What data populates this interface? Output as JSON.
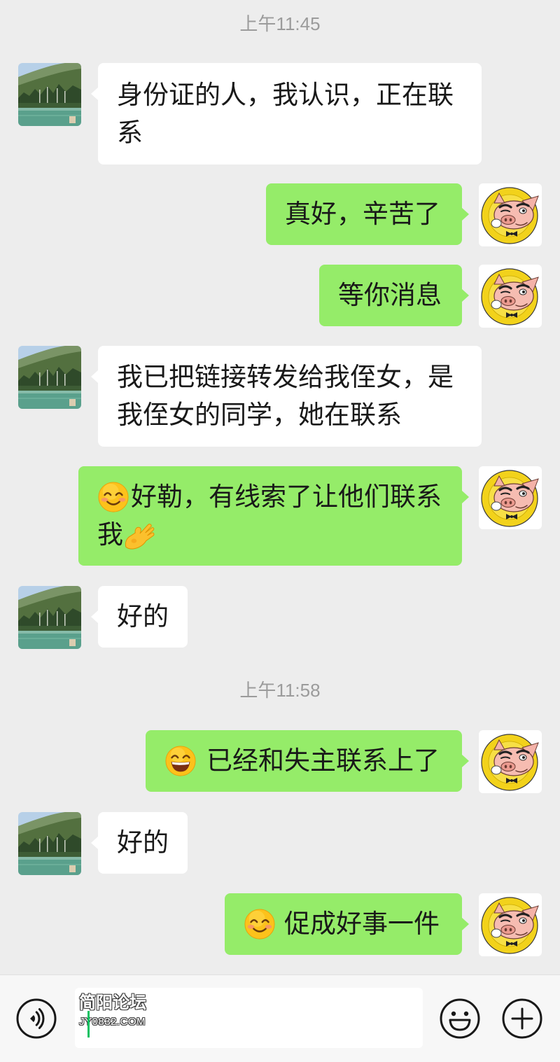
{
  "theme": {
    "chat_background": "#ededed",
    "bubble_me": "#95ec69",
    "bubble_other": "#ffffff",
    "timestamp_color": "#9b9b9b",
    "message_text_color": "#191919",
    "input_bar_background": "#f7f7f7",
    "cursor_color": "#07c160"
  },
  "avatars": {
    "other": "landscape-photo-avatar",
    "me": "pig-cartoon-avatar",
    "me_logo_text": "WWW.JY0832.COM"
  },
  "chat": {
    "timestamps": [
      "上午11:45",
      "上午11:58"
    ],
    "messages": [
      {
        "outgoing": false,
        "lines": [
          "身份证的人，我认识，正在联",
          "系"
        ]
      },
      {
        "outgoing": true,
        "lines": [
          "真好，辛苦了"
        ]
      },
      {
        "outgoing": true,
        "lines": [
          "等你消息"
        ]
      },
      {
        "outgoing": false,
        "lines": [
          "我已把链接转发给我侄女，是",
          "我侄女的同学，她在联系"
        ]
      },
      {
        "outgoing": true,
        "lines": [
          "好勒，有线索了让他们联系",
          "我"
        ],
        "emoji": [
          "smiling-face-icon",
          "ok-hand-icon"
        ]
      },
      {
        "outgoing": false,
        "lines": [
          "好的"
        ]
      },
      {
        "outgoing": true,
        "lines": [
          "已经和失主联系上了"
        ],
        "emoji": [
          "grinning-face-icon"
        ]
      },
      {
        "outgoing": false,
        "lines": [
          "好的"
        ]
      },
      {
        "outgoing": true,
        "lines": [
          "促成好事一件"
        ],
        "emoji": [
          "smiling-face-icon"
        ]
      }
    ]
  },
  "input_bar": {
    "voice_icon": "voice-icon",
    "input_value": "",
    "watermark_title": "简阳论坛",
    "watermark_url": "JY0832.COM",
    "emoji_icon": "emoji-icon",
    "plus_icon": "plus-icon"
  }
}
